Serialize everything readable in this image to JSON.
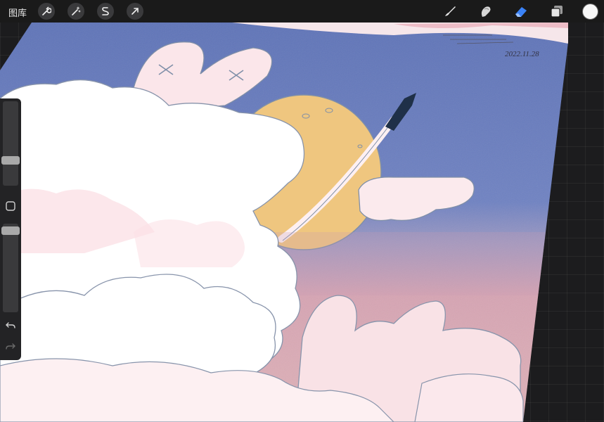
{
  "topbar": {
    "gallery_label": "图库",
    "left_tools": [
      {
        "name": "wrench-icon"
      },
      {
        "name": "magic-wand-icon"
      },
      {
        "name": "selection-icon"
      },
      {
        "name": "transform-arrow-icon"
      }
    ],
    "right_tools": [
      {
        "name": "brush-icon"
      },
      {
        "name": "smudge-icon"
      },
      {
        "name": "eraser-icon",
        "active": true
      },
      {
        "name": "layers-icon"
      }
    ],
    "current_color": "#f8f8f8",
    "accent_color": "#3a82f7"
  },
  "artwork": {
    "signature": "2022.11.28",
    "sky_color": "#6a7fbf",
    "moon_color": "#efc67f",
    "dusk_color": "#d9a3ad",
    "cloud_color": "#fdf0f2"
  },
  "sidebar": {
    "brush_size_level": 0.55,
    "opacity_level": 0.95,
    "buttons": [
      "modify-square-icon",
      "undo-icon",
      "redo-icon"
    ]
  }
}
